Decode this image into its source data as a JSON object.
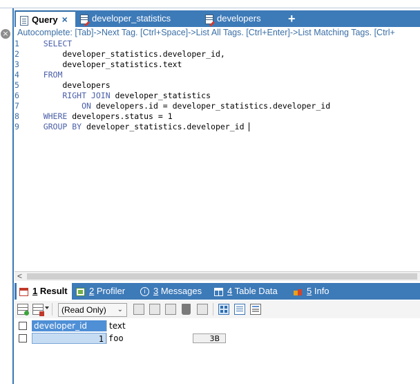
{
  "query_tabs": [
    {
      "label": "Query",
      "active": true,
      "icon": "query-doc-icon",
      "closable": true
    },
    {
      "label": "developer_statistics",
      "active": false,
      "icon": "table-edit-icon"
    },
    {
      "label": "developers",
      "active": false,
      "icon": "table-edit-icon"
    }
  ],
  "add_tab_label": "+",
  "close_marker": "×",
  "autocomplete_hint": "Autocomplete: [Tab]->Next Tag. [Ctrl+Space]->List All Tags. [Ctrl+Enter]->List Matching Tags. [Ctrl+",
  "editor": {
    "lines": [
      {
        "num": "1",
        "kw": "    SELECT",
        "rest": ""
      },
      {
        "num": "2",
        "kw": "",
        "rest": "        developer_statistics.developer_id,"
      },
      {
        "num": "3",
        "kw": "",
        "rest": "        developer_statistics.text"
      },
      {
        "num": "4",
        "kw": "    FROM",
        "rest": ""
      },
      {
        "num": "5",
        "kw": "",
        "rest": "        developers"
      },
      {
        "num": "6",
        "kw": "        RIGHT JOIN",
        "rest": " developer_statistics"
      },
      {
        "num": "7",
        "kw": "            ON",
        "rest": " developers.id = developer_statistics.developer_id"
      },
      {
        "num": "8",
        "kw": "    WHERE",
        "rest": " developers.status = 1"
      },
      {
        "num": "9",
        "kw": "    GROUP BY",
        "rest": " developer_statistics.developer_id "
      }
    ]
  },
  "scroll_arrow": "<",
  "result_tabs": [
    {
      "num": "1",
      "label": " Result",
      "active": true,
      "icon": "result-grid-icon"
    },
    {
      "num": "2",
      "label": " Profiler",
      "active": false,
      "icon": "profiler-icon"
    },
    {
      "num": "3",
      "label": " Messages",
      "active": false,
      "icon": "info-icon"
    },
    {
      "num": "4",
      "label": " Table Data",
      "active": false,
      "icon": "table-data-icon"
    },
    {
      "num": "5",
      "label": " Info",
      "active": false,
      "icon": "info-boxes-icon"
    }
  ],
  "info_glyph": "i",
  "toolbar": {
    "mode_select": {
      "value": "(Read Only)",
      "chevron": "⌄"
    }
  },
  "result_grid": {
    "columns": [
      "developer_id",
      "text"
    ],
    "rows": [
      {
        "developer_id": "1",
        "text": "foo",
        "size": "3B"
      }
    ]
  }
}
